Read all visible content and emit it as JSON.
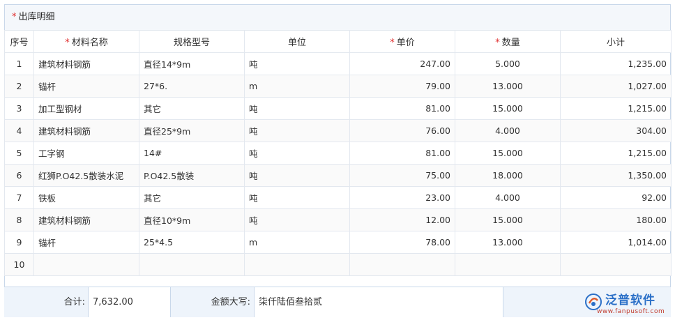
{
  "section": {
    "required_mark": "*",
    "title": "出库明细"
  },
  "columns": [
    {
      "label": "序号",
      "required": false
    },
    {
      "label": "材料名称",
      "required": true
    },
    {
      "label": "规格型号",
      "required": false
    },
    {
      "label": "单位",
      "required": false
    },
    {
      "label": "单价",
      "required": true
    },
    {
      "label": "数量",
      "required": true
    },
    {
      "label": "小计",
      "required": false
    }
  ],
  "rows": [
    {
      "no": "1",
      "name": "建筑材料钢筋",
      "spec": "直径14*9m",
      "unit": "吨",
      "price": "247.00",
      "qty": "5.000",
      "subtotal": "1,235.00"
    },
    {
      "no": "2",
      "name": "锚杆",
      "spec": "27*6.",
      "unit": "m",
      "price": "79.00",
      "qty": "13.000",
      "subtotal": "1,027.00"
    },
    {
      "no": "3",
      "name": "加工型钢材",
      "spec": "其它",
      "unit": "吨",
      "price": "81.00",
      "qty": "15.000",
      "subtotal": "1,215.00"
    },
    {
      "no": "4",
      "name": "建筑材料钢筋",
      "spec": "直径25*9m",
      "unit": "吨",
      "price": "76.00",
      "qty": "4.000",
      "subtotal": "304.00"
    },
    {
      "no": "5",
      "name": "工字钢",
      "spec": "14#",
      "unit": "吨",
      "price": "81.00",
      "qty": "15.000",
      "subtotal": "1,215.00"
    },
    {
      "no": "6",
      "name": "红狮P.O42.5散装水泥",
      "spec": "P.O42.5散装",
      "unit": "吨",
      "price": "75.00",
      "qty": "18.000",
      "subtotal": "1,350.00"
    },
    {
      "no": "7",
      "name": "铁板",
      "spec": "其它",
      "unit": "吨",
      "price": "23.00",
      "qty": "4.000",
      "subtotal": "92.00"
    },
    {
      "no": "8",
      "name": "建筑材料钢筋",
      "spec": "直径10*9m",
      "unit": "吨",
      "price": "12.00",
      "qty": "15.000",
      "subtotal": "180.00"
    },
    {
      "no": "9",
      "name": "锚杆",
      "spec": "25*4.5",
      "unit": "m",
      "price": "78.00",
      "qty": "13.000",
      "subtotal": "1,014.00"
    },
    {
      "no": "10",
      "name": "",
      "spec": "",
      "unit": "",
      "price": "",
      "qty": "",
      "subtotal": ""
    }
  ],
  "footer": {
    "total_label": "合计:",
    "total_value": "7,632.00",
    "amount_label": "金额大写:",
    "amount_value": "柒仟陆佰叁拾贰"
  },
  "logo": {
    "brand": "泛普软件",
    "url": "www.fanpusoft.com"
  },
  "colors": {
    "required": "#e03030",
    "border": "#c9d8ea",
    "brand": "#2a6fc7"
  }
}
